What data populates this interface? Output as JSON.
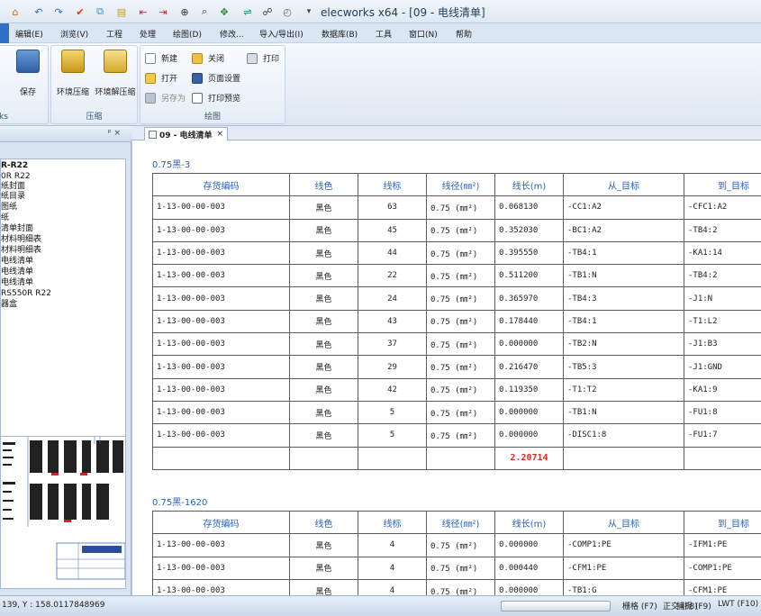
{
  "window": {
    "title": "elecworks x64 - [09 - 电线清单]"
  },
  "menu": {
    "items": [
      "编辑(E)",
      "浏览(V)",
      "工程",
      "处理",
      "绘图(D)",
      "修改...",
      "导入/导出(I)",
      "数据库(B)",
      "工具",
      "窗口(N)",
      "帮助"
    ]
  },
  "ribbon": {
    "save_label": "保存",
    "works_group_label": "ks",
    "compress_label": "环境压缩",
    "decompress_label": "环境解压缩",
    "compress_group_label": "压缩",
    "new_label": "新建",
    "close_label": "关闭",
    "print_label": "打印",
    "open_label": "打开",
    "page_setup_label": "页面设置",
    "save_as_label": "另存为",
    "print_preview_label": "打印预览",
    "drawing_group_label": "绘图"
  },
  "leftpanel": {
    "pin_label": "ᵖ ×",
    "tree_items": [
      "R-R22",
      "0R R22",
      "纸封面",
      "纸目录",
      "图纸",
      "纸",
      "清单封面",
      "材料明细表",
      "材料明细表",
      "电线清单",
      "电线清单",
      "电线清单",
      "RS550R R22",
      "器盒"
    ]
  },
  "doc_tab": {
    "label": "09 - 电线清单",
    "close": "×"
  },
  "table1": {
    "title": "0.75黑-3",
    "headers": [
      "存货编码",
      "线色",
      "线标",
      "线径(㎜²)",
      "线长(m)",
      "从_目标",
      "到_目标"
    ],
    "rows": [
      [
        "1-13-00-00-003",
        "黑色",
        "63",
        "0.75 (㎜²)",
        "0.068130",
        "-CC1:A2",
        "-CFC1:A2"
      ],
      [
        "1-13-00-00-003",
        "黑色",
        "45",
        "0.75 (㎜²)",
        "0.352030",
        "-BC1:A2",
        "-TB4:2"
      ],
      [
        "1-13-00-00-003",
        "黑色",
        "44",
        "0.75 (㎜²)",
        "0.395550",
        "-TB4:1",
        "-KA1:14"
      ],
      [
        "1-13-00-00-003",
        "黑色",
        "22",
        "0.75 (㎜²)",
        "0.511200",
        "-TB1:N",
        "-TB4:2"
      ],
      [
        "1-13-00-00-003",
        "黑色",
        "24",
        "0.75 (㎜²)",
        "0.365970",
        "-TB4:3",
        "-J1:N"
      ],
      [
        "1-13-00-00-003",
        "黑色",
        "43",
        "0.75 (㎜²)",
        "0.178440",
        "-TB4:1",
        "-T1:L2"
      ],
      [
        "1-13-00-00-003",
        "黑色",
        "37",
        "0.75 (㎜²)",
        "0.000000",
        "-TB2:N",
        "-J1:B3"
      ],
      [
        "1-13-00-00-003",
        "黑色",
        "29",
        "0.75 (㎜²)",
        "0.216470",
        "-TB5:3",
        "-J1:GND"
      ],
      [
        "1-13-00-00-003",
        "黑色",
        "42",
        "0.75 (㎜²)",
        "0.119350",
        "-T1:T2",
        "-KA1:9"
      ],
      [
        "1-13-00-00-003",
        "黑色",
        "5",
        "0.75 (㎜²)",
        "0.000000",
        "-TB1:N",
        "-FU1:8"
      ],
      [
        "1-13-00-00-003",
        "黑色",
        "5",
        "0.75 (㎜²)",
        "0.000000",
        "-DISC1:8",
        "-FU1:7"
      ]
    ],
    "total": "2.20714"
  },
  "table2": {
    "title": "0.75黑-1620",
    "headers": [
      "存货编码",
      "线色",
      "线标",
      "线径(㎜²)",
      "线长(m)",
      "从_目标",
      "到_目标"
    ],
    "rows": [
      [
        "1-13-00-00-003",
        "黑色",
        "4",
        "0.75 (㎜²)",
        "0.000000",
        "-COMP1:PE",
        "-IFM1:PE"
      ],
      [
        "1-13-00-00-003",
        "黑色",
        "4",
        "0.75 (㎜²)",
        "0.000440",
        "-CFM1:PE",
        "-COMP1:PE"
      ],
      [
        "1-13-00-00-003",
        "黑色",
        "4",
        "0.75 (㎜²)",
        "0.000000",
        "-TB1:G",
        "-CFM1:PE"
      ]
    ]
  },
  "status": {
    "coords": "139, Y : 158.0117848969",
    "grid": "栅格 (F7)",
    "ortho": "正交 (F8)",
    "snap": "捕捉 (F9)",
    "lwt": "LWT (F10)"
  },
  "colors": {
    "header_blue": "#2a62b8",
    "total_red": "#e8281e",
    "ribbon_bg": "#dde7f3"
  }
}
